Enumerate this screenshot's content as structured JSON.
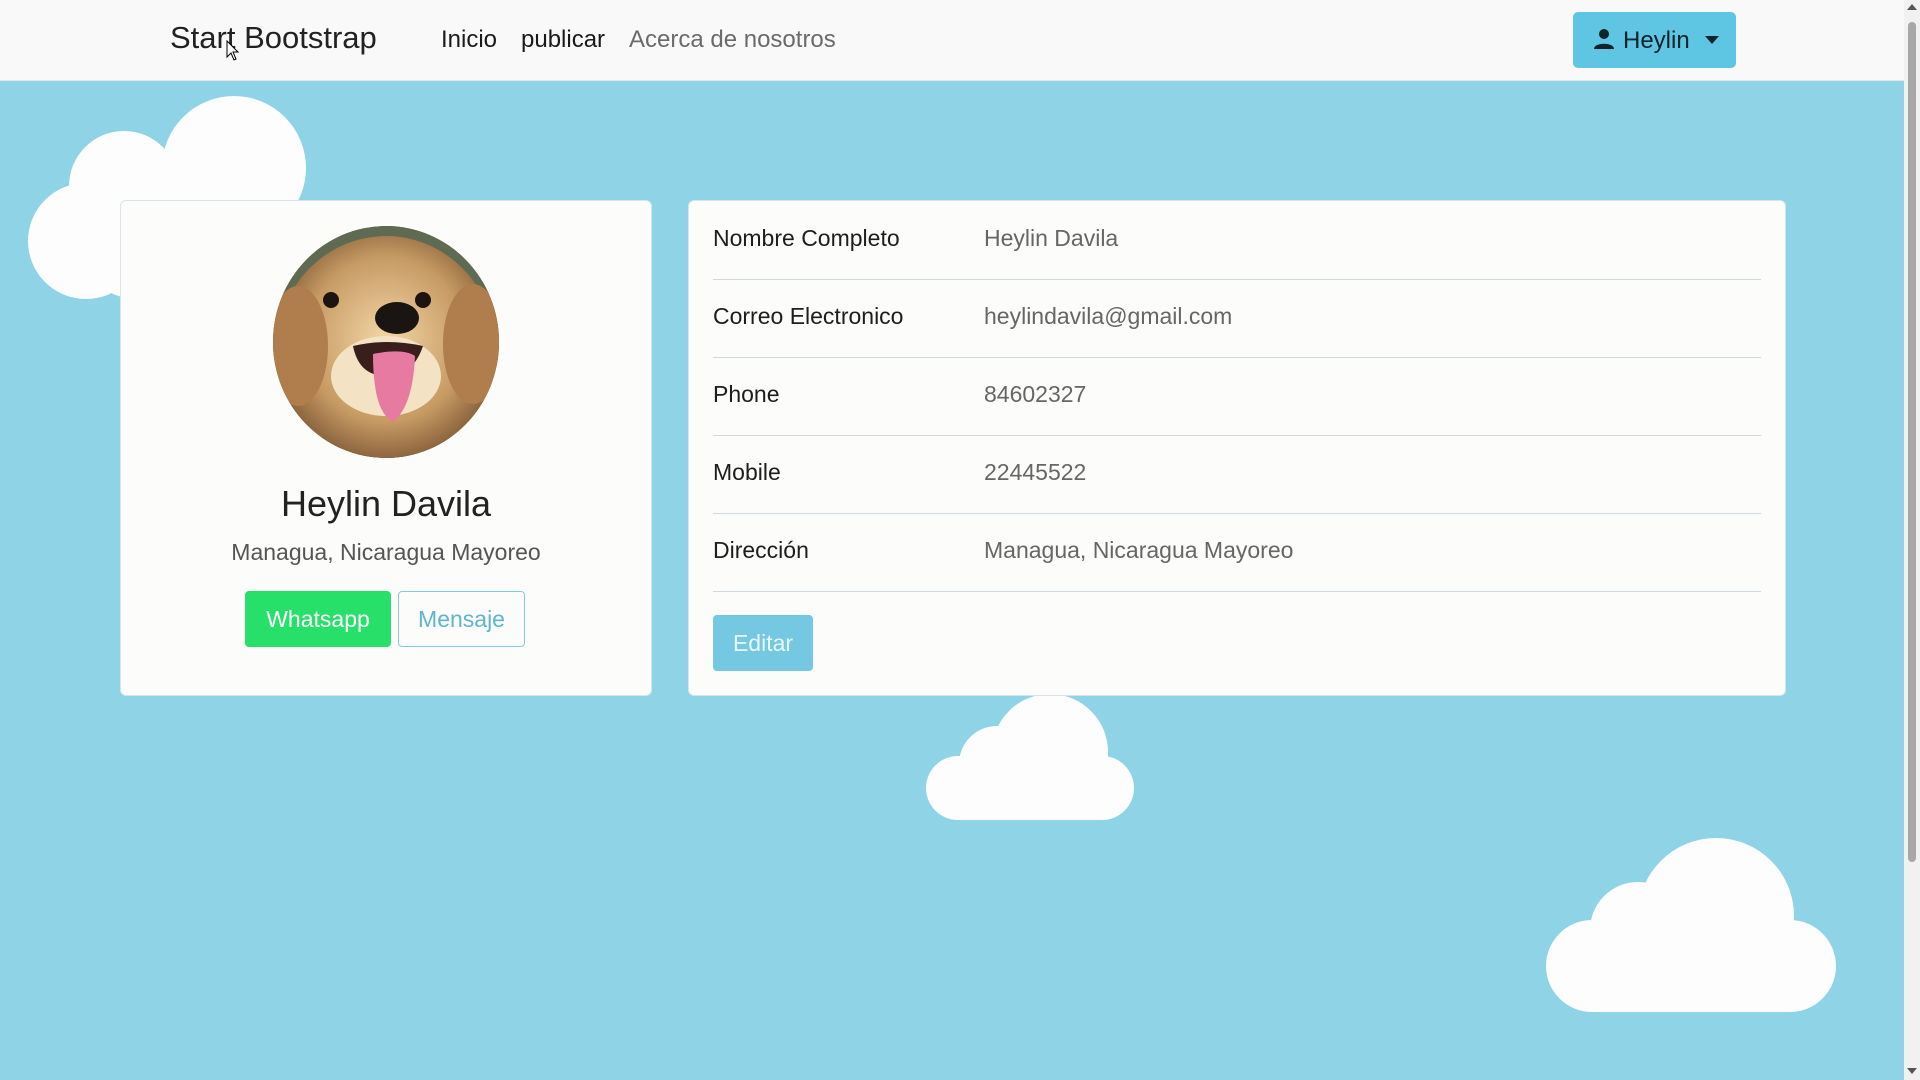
{
  "navbar": {
    "brand": "Start Bootstrap",
    "links": [
      {
        "label": "Inicio"
      },
      {
        "label": "publicar"
      },
      {
        "label": "Acerca de nosotros"
      }
    ],
    "user_label": "Heylin",
    "user_icon": "user-icon",
    "caret_icon": "chevron-down-icon"
  },
  "profile": {
    "name": "Heylin Davila",
    "location": "Managua, Nicaragua Mayoreo",
    "whatsapp_label": "Whatsapp",
    "message_label": "Mensaje",
    "avatar": "puppy-photo"
  },
  "details": {
    "rows": [
      {
        "label": "Nombre Completo",
        "value": "Heylin Davila"
      },
      {
        "label": "Correo Electronico",
        "value": "heylindavila@gmail.com"
      },
      {
        "label": "Phone",
        "value": "84602327"
      },
      {
        "label": "Mobile",
        "value": "22445522"
      },
      {
        "label": "Dirección",
        "value": "Managua, Nicaragua Mayoreo"
      }
    ],
    "edit_label": "Editar"
  },
  "colors": {
    "background": "#8fd3e6",
    "navbar": "#f9f9f9",
    "user_button": "#5ec5e3",
    "whatsapp": "#27e06a",
    "edit_button": "#74c8e2"
  }
}
